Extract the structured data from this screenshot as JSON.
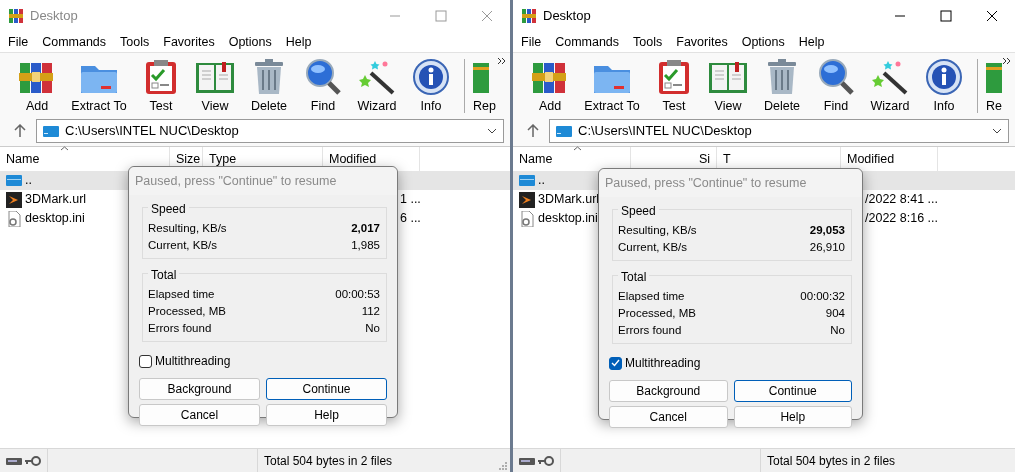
{
  "windows": [
    {
      "title": "Desktop",
      "active": false,
      "menu": [
        "File",
        "Commands",
        "Tools",
        "Favorites",
        "Options",
        "Help"
      ],
      "toolbar": [
        "Add",
        "Extract To",
        "Test",
        "View",
        "Delete",
        "Find",
        "Wizard",
        "Info",
        "Rep"
      ],
      "path": "C:\\Users\\INTEL NUC\\Desktop",
      "columns": [
        "Name",
        "Size",
        "Type",
        "Modified"
      ],
      "rows": [
        {
          "name": "..",
          "modified": "",
          "selected": true,
          "kind": "folder"
        },
        {
          "name": "3DMark.url",
          "modified": "1 ...",
          "selected": false,
          "kind": "shortcut"
        },
        {
          "name": "desktop.ini",
          "modified": "6 ...",
          "selected": false,
          "kind": "settings"
        }
      ],
      "status": "Total 504 bytes in 2 files",
      "dialog": {
        "title": "Paused, press \"Continue\" to resume",
        "groups": [
          {
            "title": "Speed",
            "rows": [
              {
                "label": "Resulting, KB/s",
                "value": "2,017",
                "bold": true
              },
              {
                "label": "Current, KB/s",
                "value": "1,985",
                "bold": false
              }
            ]
          },
          {
            "title": "Total",
            "rows": [
              {
                "label": "Elapsed time",
                "value": "00:00:53",
                "bold": false
              },
              {
                "label": "Processed, MB",
                "value": "112",
                "bold": false
              },
              {
                "label": "Errors found",
                "value": "No",
                "bold": false
              }
            ]
          }
        ],
        "multithreading": {
          "label": "Multithreading",
          "checked": false
        },
        "buttons": [
          {
            "label": "Background",
            "default": false
          },
          {
            "label": "Continue",
            "default": true
          },
          {
            "label": "Cancel",
            "default": false
          },
          {
            "label": "Help",
            "default": false
          }
        ]
      }
    },
    {
      "title": "Desktop",
      "active": true,
      "menu": [
        "File",
        "Commands",
        "Tools",
        "Favorites",
        "Options",
        "Help"
      ],
      "toolbar": [
        "Add",
        "Extract To",
        "Test",
        "View",
        "Delete",
        "Find",
        "Wizard",
        "Info",
        "Re"
      ],
      "path": "C:\\Users\\INTEL NUC\\Desktop",
      "columns": [
        "Name",
        "Si",
        "T",
        "Modified"
      ],
      "rows": [
        {
          "name": "..",
          "modified": "",
          "selected": true,
          "kind": "folder"
        },
        {
          "name": "3DMark.url",
          "modified": "/2022 8:41 ...",
          "selected": false,
          "kind": "shortcut"
        },
        {
          "name": "desktop.ini",
          "modified": "/2022 8:16 ...",
          "selected": false,
          "kind": "settings"
        }
      ],
      "status": "Total 504 bytes in 2 files",
      "dialog": {
        "title": "Paused, press \"Continue\" to resume",
        "groups": [
          {
            "title": "Speed",
            "rows": [
              {
                "label": "Resulting, KB/s",
                "value": "29,053",
                "bold": true
              },
              {
                "label": "Current, KB/s",
                "value": "26,910",
                "bold": false
              }
            ]
          },
          {
            "title": "Total",
            "rows": [
              {
                "label": "Elapsed time",
                "value": "00:00:32",
                "bold": false
              },
              {
                "label": "Processed, MB",
                "value": "904",
                "bold": false
              },
              {
                "label": "Errors found",
                "value": "No",
                "bold": false
              }
            ]
          }
        ],
        "multithreading": {
          "label": "Multithreading",
          "checked": true
        },
        "buttons": [
          {
            "label": "Background",
            "default": false
          },
          {
            "label": "Continue",
            "default": true
          },
          {
            "label": "Cancel",
            "default": false
          },
          {
            "label": "Help",
            "default": false
          }
        ]
      }
    }
  ]
}
